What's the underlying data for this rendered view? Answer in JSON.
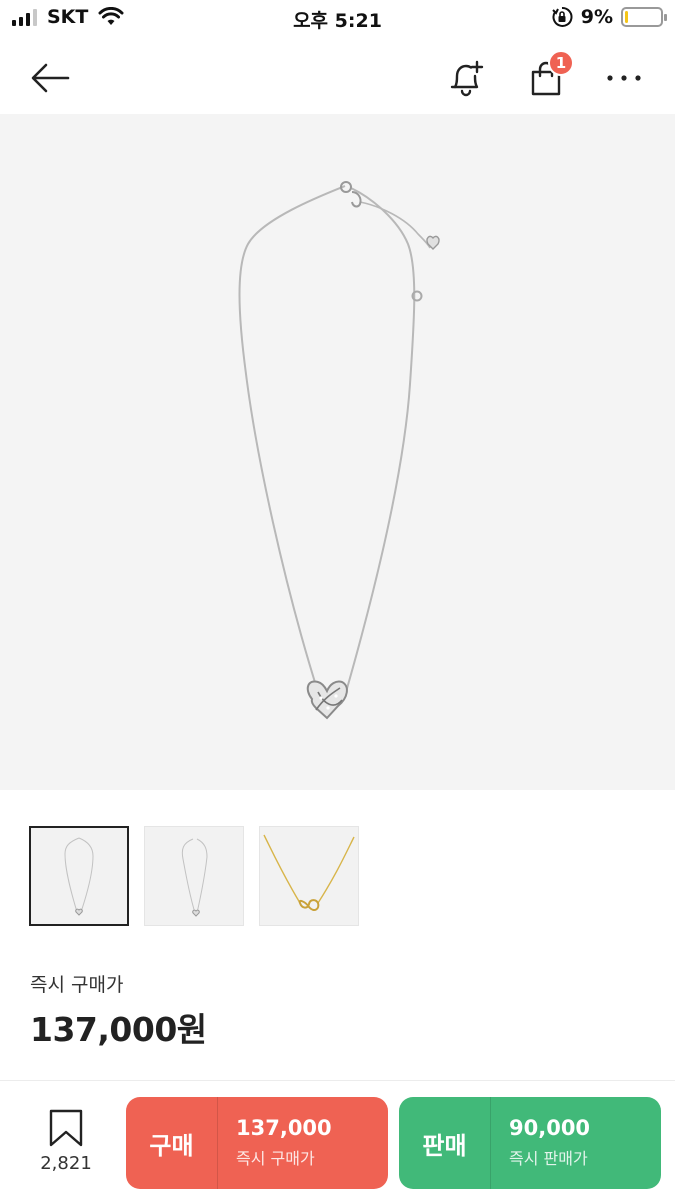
{
  "status_bar": {
    "carrier": "SKT",
    "time": "오후 5:21",
    "battery_percent": "9%",
    "battery_level": 0.09,
    "battery_color": "#f5c518"
  },
  "nav": {
    "back_icon": "arrow-left-icon",
    "bell_icon": "bell-plus-icon",
    "bag_icon": "shopping-bag-icon",
    "cart_badge": "1",
    "more_icon": "more-horizontal-icon"
  },
  "product": {
    "thumbnails": [
      {
        "icon": "silver-necklace",
        "selected": true
      },
      {
        "icon": "silver-necklace",
        "selected": false
      },
      {
        "icon": "gold-necklace",
        "selected": false
      }
    ],
    "price_label": "즉시 구매가",
    "price_value": "137,000원"
  },
  "bottom_bar": {
    "wish_count": "2,821",
    "buy": {
      "label": "구매",
      "price": "137,000",
      "sub": "즉시 구매가",
      "color": "#ef6253"
    },
    "sell": {
      "label": "판매",
      "price": "90,000",
      "sub": "즉시 판매가",
      "color": "#41b979"
    }
  }
}
